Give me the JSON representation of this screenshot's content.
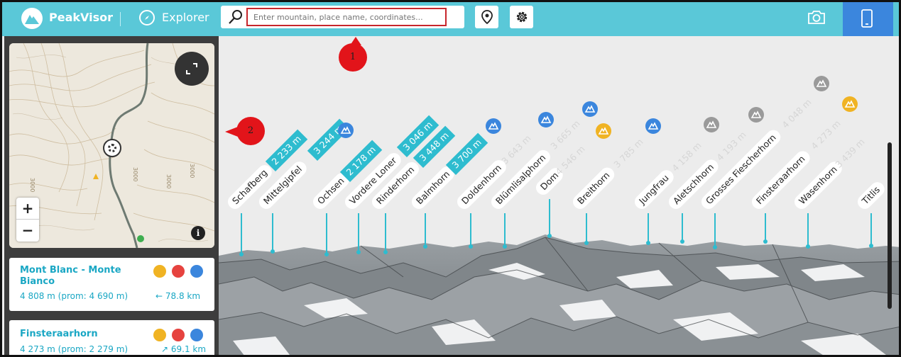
{
  "app": {
    "brand": "PeakVisor",
    "nav_explorer": "Explorer"
  },
  "search": {
    "placeholder": "Enter mountain, place name, coordinates..."
  },
  "colors": {
    "accent": "#5ac8d8",
    "peak_blue": "#2ebccf",
    "mobile_blue": "#3b86dd",
    "marker_red": "#e2141a",
    "icon_yellow": "#f0b323",
    "icon_grey": "#9a9a9a",
    "icon_red": "#e6433f",
    "icon_dark_blue": "#3b86dd"
  },
  "map": {
    "zoom_in": "+",
    "zoom_out": "−",
    "info": "i",
    "contours": [
      "3000",
      "3000",
      "3000",
      "3000"
    ]
  },
  "cards": [
    {
      "title": "Mont Blanc - Monte Bianco",
      "meta": "4 808 m (prom: 4 690 m)",
      "distance": "78.8 km",
      "direction": "←"
    },
    {
      "title": "Finsteraarhorn",
      "meta": "4 273 m (prom: 2 279 m)",
      "distance": "69.1 km",
      "direction": "↗"
    }
  ],
  "peaks": [
    {
      "name": "Schafberg",
      "alt": "2 233 m",
      "style": "pill"
    },
    {
      "name": "Mittelgipfel",
      "alt": "3 244 m",
      "style": "pill"
    },
    {
      "name": "Ochsen",
      "alt": "2 178 m",
      "style": "pill"
    },
    {
      "name": "Vordere Loner",
      "alt": "3 046 m",
      "style": "pill"
    },
    {
      "name": "Rinderhorn",
      "alt": "3 448 m",
      "style": "pill"
    },
    {
      "name": "Balmhorn",
      "alt": "3 700 m",
      "style": "pill"
    },
    {
      "name": "Doldenhorn",
      "alt": "3 643 m",
      "style": "faint"
    },
    {
      "name": "Blümlisalphorn",
      "alt": "3 665 m",
      "style": "faint"
    },
    {
      "name": "Dom",
      "alt": "4 546 m",
      "style": "faint"
    },
    {
      "name": "Breithorn",
      "alt": "3 785 m",
      "style": "faint"
    },
    {
      "name": "Jungfrau",
      "alt": "4 158 m",
      "style": "faint"
    },
    {
      "name": "Aletschhorn",
      "alt": "4 193 m",
      "style": "faint"
    },
    {
      "name": "Grosses Fiescherhorn",
      "alt": "4 048 m",
      "style": "faint"
    },
    {
      "name": "Finsteraarhorn",
      "alt": "4 273 m",
      "style": "faint"
    },
    {
      "name": "Wasenhorn",
      "alt": "3 439 m",
      "style": "faint"
    },
    {
      "name": "Titlis",
      "alt": "",
      "style": "faint"
    }
  ],
  "markers": {
    "one": "1",
    "two": "2"
  }
}
